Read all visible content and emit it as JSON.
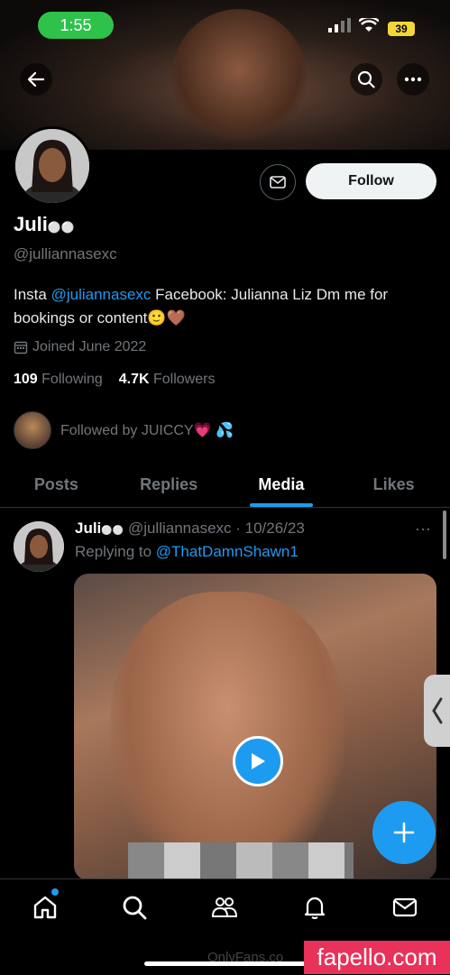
{
  "status_bar": {
    "time": "1:55",
    "battery": "39"
  },
  "profile": {
    "display_name": "Juli",
    "name_emoji": "⚪⚪",
    "handle": "@julliannasexc",
    "bio_prefix": "Insta ",
    "bio_link": "@juliannasexc",
    "bio_rest": " Facebook: Julianna Liz Dm me for bookings or content🙂🤎",
    "joined": "Joined June 2022",
    "following_count": "109",
    "following_label": "Following",
    "followers_count": "4.7K",
    "followers_label": "Followers",
    "followed_by": "Followed by JUICCY💗 💦",
    "follow_label": "Follow"
  },
  "tabs": [
    "Posts",
    "Replies",
    "Media",
    "Likes"
  ],
  "active_tab": "Media",
  "tweet": {
    "name": "Juli",
    "name_emoji": "⚪⚪",
    "handle_date": "@julliannasexc · 10/26/23",
    "replying_prefix": "Replying to ",
    "replying_to": "@ThatDamnShawn1",
    "more": "···"
  },
  "watermarks": {
    "onlyfans": "OnlyFans.co",
    "fapello": "fapello.com"
  },
  "colors": {
    "accent": "#1d9bf0",
    "status_green": "#2fc24a",
    "battery": "#f5d63a",
    "fapello": "#e8325a"
  },
  "icons": [
    "back-arrow-icon",
    "search-icon",
    "more-icon",
    "mail-icon",
    "calendar-icon",
    "play-icon",
    "plus-icon",
    "home-icon",
    "search-nav-icon",
    "people-icon",
    "bell-icon",
    "mail-nav-icon"
  ]
}
